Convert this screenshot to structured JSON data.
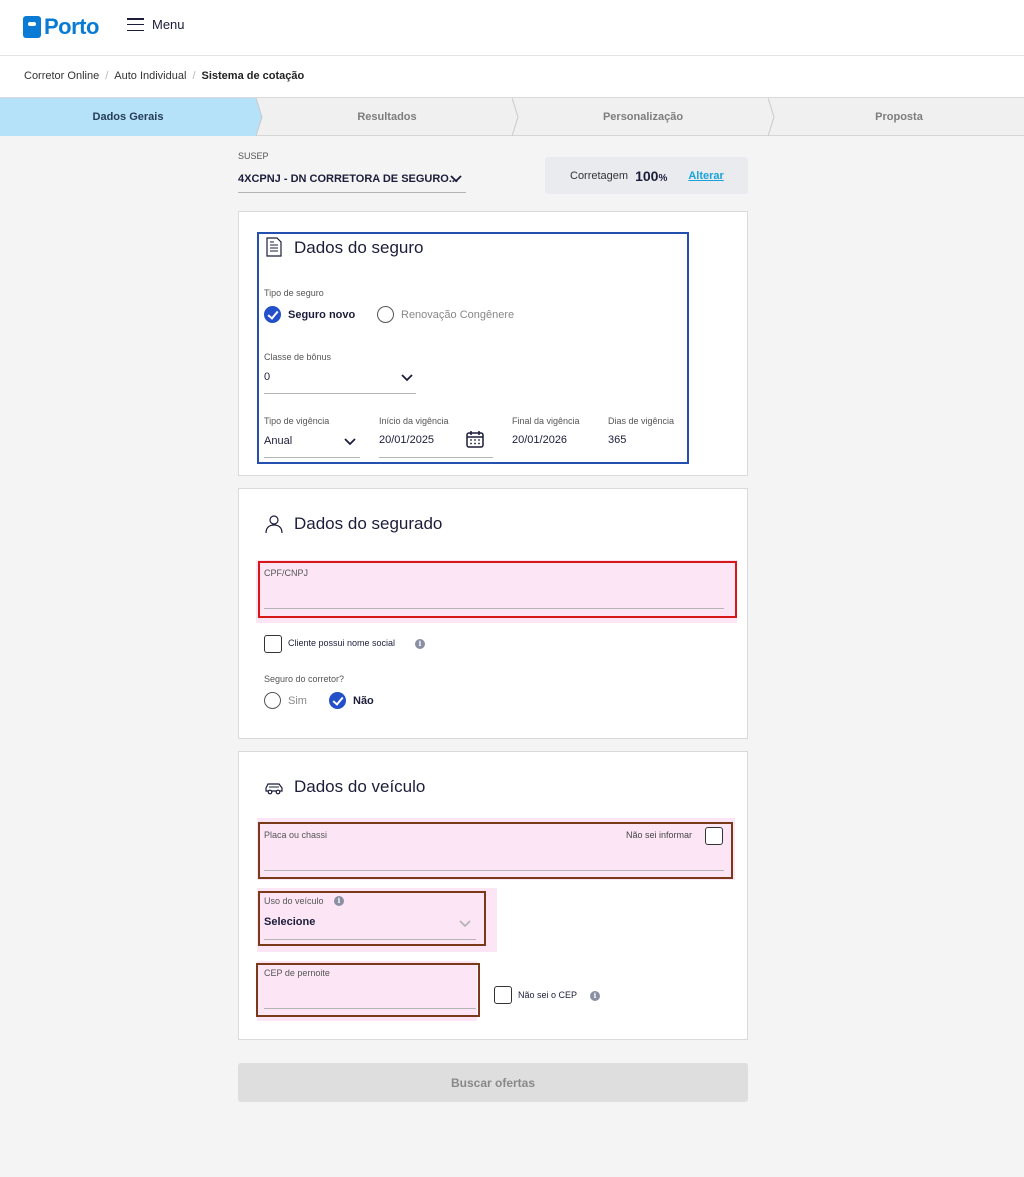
{
  "header": {
    "logo": "Porto",
    "menu_label": "Menu"
  },
  "breadcrumb": [
    "Corretor Online",
    "Auto Individual",
    "Sistema de cotação"
  ],
  "steps": [
    "Dados Gerais",
    "Resultados",
    "Personalização",
    "Proposta"
  ],
  "active_step": 0,
  "susep": {
    "label": "SUSEP",
    "value": "4XCPNJ - DN CORRETORA DE SEGURO..."
  },
  "corretagem": {
    "label": "Corretagem",
    "value": "100",
    "unit": "%",
    "action": "Alterar"
  },
  "seguro": {
    "title": "Dados do seguro",
    "tipo_label": "Tipo de seguro",
    "options": [
      "Seguro novo",
      "Renovação Congênere"
    ],
    "selected": "Seguro novo",
    "bonus_label": "Classe de bônus",
    "bonus_value": "0",
    "vigencia_label": "Tipo de vigência",
    "vigencia_value": "Anual",
    "inicio_label": "Início da vigência",
    "inicio_value": "20/01/2025",
    "final_label": "Final da vigência",
    "final_value": "20/01/2026",
    "dias_label": "Dias de vigência",
    "dias_value": "365"
  },
  "segurado": {
    "title": "Dados do segurado",
    "cpf_label": "CPF/CNPJ",
    "cpf_value": "",
    "nome_social_label": "Cliente possui nome social",
    "corretor_label": "Seguro do corretor?",
    "options": [
      "Sim",
      "Não"
    ],
    "selected": "Não"
  },
  "veiculo": {
    "title": "Dados do veículo",
    "placa_label": "Placa ou chassi",
    "placa_value": "",
    "nao_sei_label": "Não sei informar",
    "uso_label": "Uso do veículo",
    "uso_value": "Selecione",
    "cep_label": "CEP de pernoite",
    "cep_value": "",
    "nao_sei_cep_label": "Não sei o CEP"
  },
  "buscar_label": "Buscar ofertas",
  "colors": {
    "brand": "#0a7bd4",
    "active_step": "#b5e1f9",
    "check": "#2350c9",
    "link": "#1aa2d9"
  }
}
